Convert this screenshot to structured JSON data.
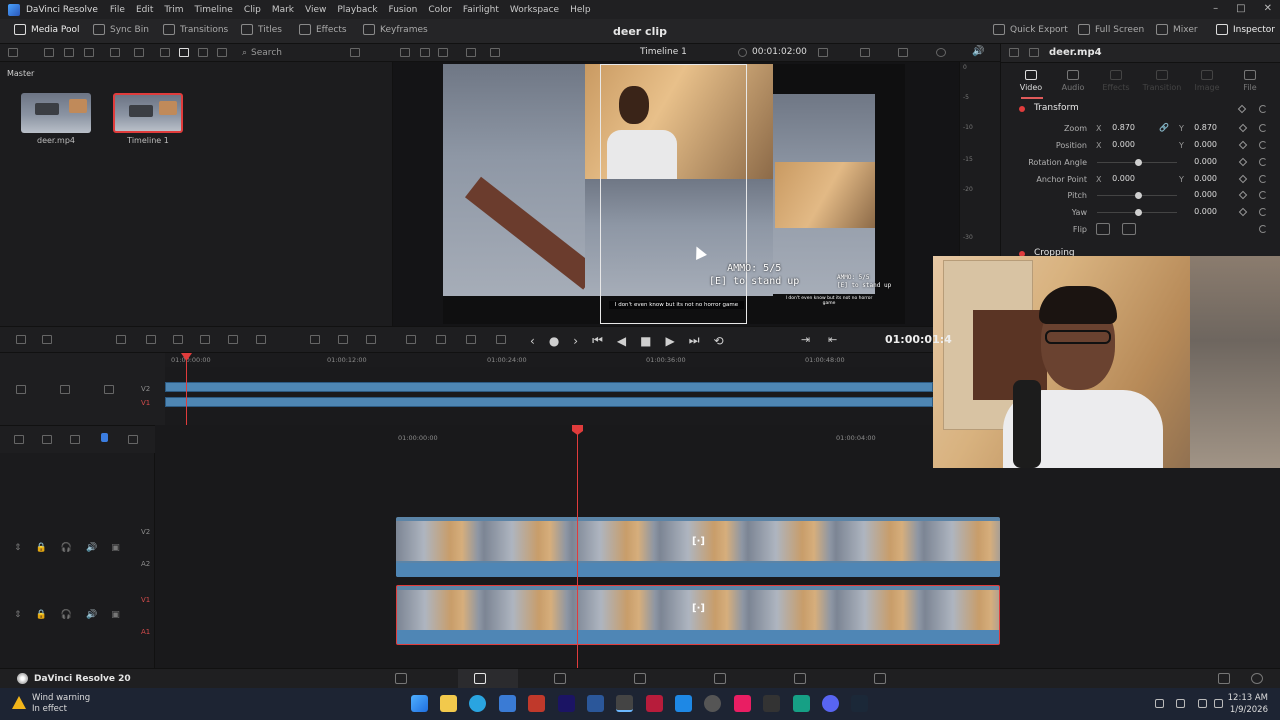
{
  "menubar": {
    "app_name": "DaVinci Resolve",
    "items": [
      "File",
      "Edit",
      "Trim",
      "Timeline",
      "Clip",
      "Mark",
      "View",
      "Playback",
      "Fusion",
      "Color",
      "Fairlight",
      "Workspace",
      "Help"
    ]
  },
  "toolbar": {
    "media_pool": "Media Pool",
    "sync_bin": "Sync Bin",
    "transitions": "Transitions",
    "titles": "Titles",
    "effects": "Effects",
    "keyframes": "Keyframes",
    "project_title": "deer clip",
    "quick_export": "Quick Export",
    "full_screen": "Full Screen",
    "mixer": "Mixer",
    "inspector": "Inspector"
  },
  "subbar": {
    "search_placeholder": "Search",
    "timeline_name": "Timeline 1",
    "timecode": "00:01:02:00"
  },
  "mediapool": {
    "bin": "Master",
    "clips": [
      {
        "name": "deer.mp4"
      },
      {
        "name": "Timeline 1"
      }
    ]
  },
  "viewer": {
    "ammo_line1": "AMMO: 5/5",
    "ammo_line2": "[E] to stand up",
    "ammo_small_1": "AMMO: 5/5",
    "ammo_small_2": "[E] to stand up",
    "caption": "I don't even know but its not no horror game",
    "caption_small": "I don't even know but its not no horror game",
    "timecode": "01:00:01:4"
  },
  "meters": {
    "ticks": [
      "0",
      "-5",
      "-10",
      "-15",
      "-20",
      "-30"
    ]
  },
  "inspector": {
    "file_name": "deer.mp4",
    "tabs": [
      "Video",
      "Audio",
      "Effects",
      "Transition",
      "Image",
      "File"
    ],
    "transform_title": "Transform",
    "cropping_title": "Cropping",
    "props": {
      "zoom": {
        "label": "Zoom",
        "x": "0.870",
        "y": "0.870"
      },
      "position": {
        "label": "Position",
        "x": "0.000",
        "y": "0.000"
      },
      "rotation": {
        "label": "Rotation Angle",
        "value": "0.000"
      },
      "anchor": {
        "label": "Anchor Point",
        "x": "0.000",
        "y": "0.000"
      },
      "pitch": {
        "label": "Pitch",
        "value": "0.000"
      },
      "yaw": {
        "label": "Yaw",
        "value": "0.000"
      },
      "flip": {
        "label": "Flip"
      }
    },
    "axis_x": "X",
    "axis_y": "Y"
  },
  "timeline": {
    "upper_ruler": [
      "01:00:00:00",
      "01:00:12:00",
      "01:00:24:00",
      "01:00:36:00",
      "01:00:48:00"
    ],
    "lower_ruler": [
      "01:00:00:00",
      "01:00:04:00"
    ],
    "upper_tracks": [
      "V2",
      "V1"
    ],
    "lower_tracks": [
      "V2",
      "A2",
      "V1",
      "A1"
    ]
  },
  "pagebar": {
    "brand": "DaVinci Resolve 20"
  },
  "taskbar": {
    "weather_title": "Wind warning",
    "weather_sub": "In effect",
    "time": "12:13 AM",
    "date": "1/9/2026"
  }
}
